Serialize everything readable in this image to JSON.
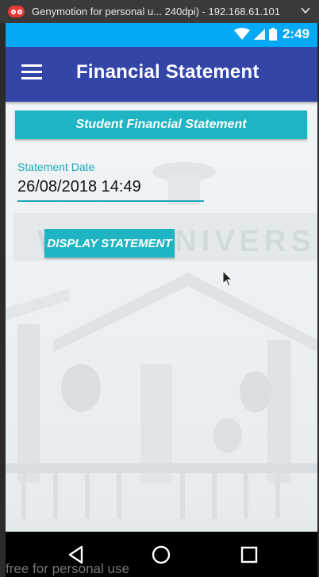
{
  "window": {
    "title": "Genymotion for personal u... 240dpi) - 192.168.61.101"
  },
  "status_bar": {
    "time": "2:49"
  },
  "app_bar": {
    "title": "Financial Statement",
    "menu_icon": "hamburger-menu-icon"
  },
  "content": {
    "banner_label": "Student Financial Statement",
    "date_label": "Statement Date",
    "date_value": "26/08/2018 14:49",
    "display_button_label": "DISPLAY STATEMENT",
    "background_text": "WANI UNIVERSITY"
  },
  "nav_bar": {
    "icons": [
      "back-icon",
      "home-icon",
      "recents-icon"
    ]
  },
  "watermark": "free for personal use",
  "colors": {
    "status_bar": "#03a9f4",
    "app_bar": "#3346a8",
    "accent": "#1eb4c3"
  }
}
